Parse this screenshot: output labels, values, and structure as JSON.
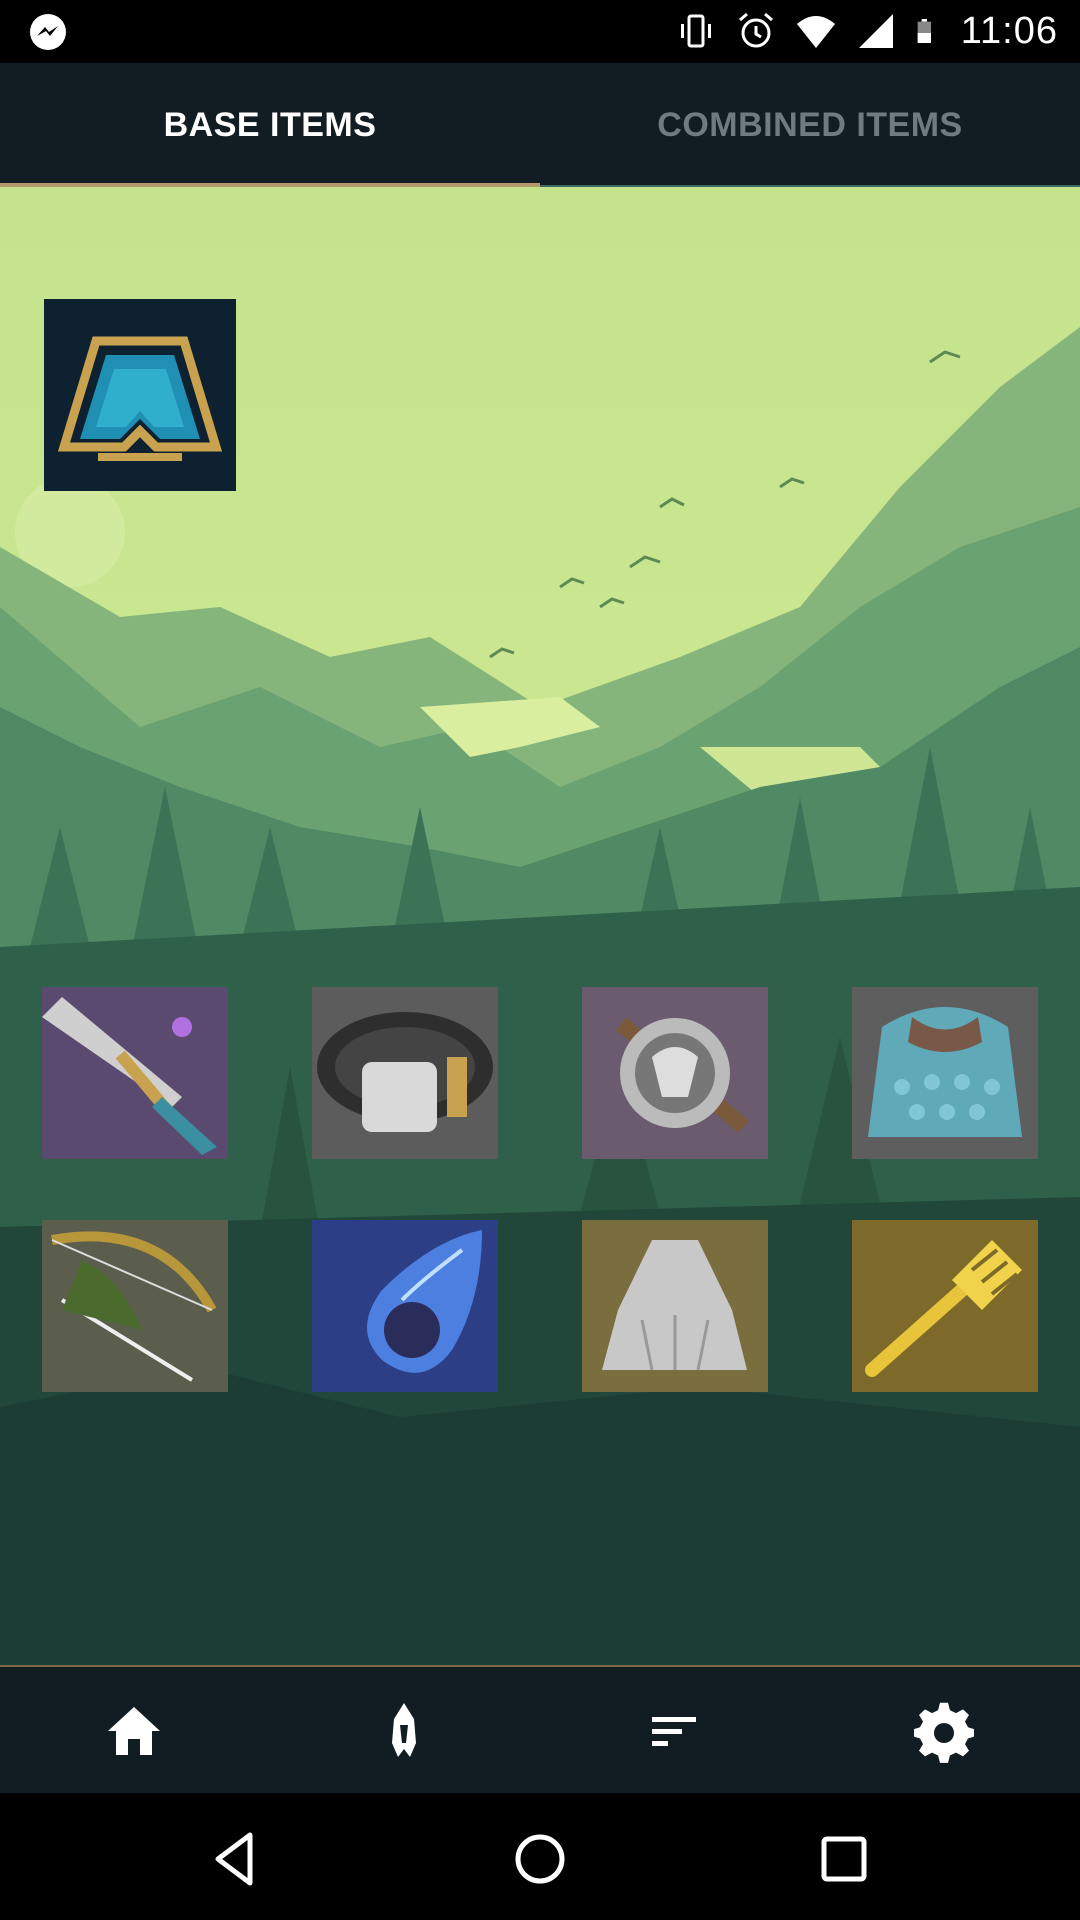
{
  "status_bar": {
    "time": "11:06",
    "icons": [
      "messenger-icon",
      "vibrate-icon",
      "alarm-icon",
      "wifi-icon",
      "signal-icon",
      "battery-icon"
    ]
  },
  "tabs": [
    {
      "label": "BASE ITEMS",
      "selected": true
    },
    {
      "label": "COMBINED ITEMS",
      "selected": false
    }
  ],
  "featured_item": {
    "icon": "spatula-emblem-icon"
  },
  "items": [
    {
      "icon": "sword-icon"
    },
    {
      "icon": "gauntlet-belt-icon"
    },
    {
      "icon": "ram-emblem-icon"
    },
    {
      "icon": "chain-vest-icon"
    },
    {
      "icon": "bow-icon"
    },
    {
      "icon": "tear-icon"
    },
    {
      "icon": "cloak-icon"
    },
    {
      "icon": "spatula-icon"
    }
  ],
  "bottom_nav": [
    "home-icon",
    "champion-helmet-icon",
    "sort-icon",
    "settings-icon"
  ],
  "system_nav": [
    "back-icon",
    "home-circle-icon",
    "recents-icon"
  ],
  "colors": {
    "tab_bg": "#111c23",
    "tab_indicator": "#b49a6a",
    "sky": "#c6e48f",
    "forest_dark": "#1f3d33"
  }
}
